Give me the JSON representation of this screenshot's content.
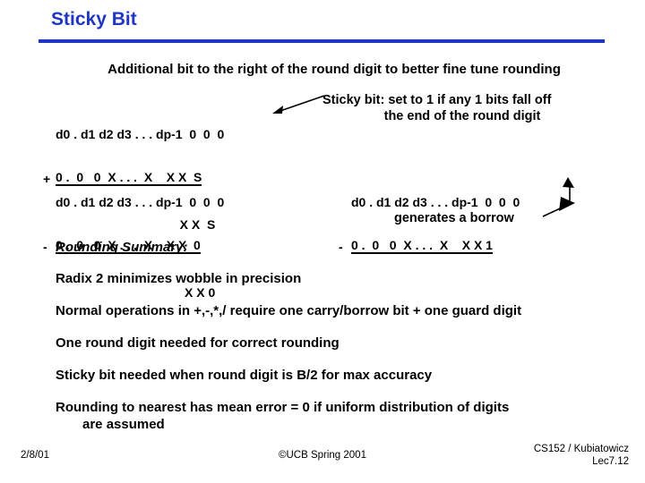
{
  "slide": {
    "title": "Sticky Bit",
    "accent_color": "#1F35C4",
    "lead_line": "Additional bit to the right of the round digit to better fine tune rounding"
  },
  "add_block": {
    "operand_top": "d0 . d1 d2 d3 . . . dp-1  0  0  0",
    "operator": "+",
    "operand_bottom": "0 .  0   0  X . . .  X    X X  S",
    "result": "X X  S"
  },
  "sticky_callout": {
    "line1": "Sticky bit:  set to 1 if any 1 bits fall off",
    "line2": "the end of the round digit",
    "arrow": "arrow-left-down"
  },
  "sub_block": {
    "operand_top": "d0 . d1 d2 d3 . . . dp-1  0  0  0",
    "operator": "-",
    "operand_bottom": "0 .  0   0  X . . .  X    X X  0",
    "result": "X X 0"
  },
  "borrow_block": {
    "operand_top": "d0 . d1 d2 d3 . . . dp-1  0  0  0",
    "operator": "-",
    "operand_bottom": "0 .  0   0  X . . .  X    X X 1",
    "caption": "generates a borrow",
    "arrow": "arrow-hook-up-left"
  },
  "summary": {
    "heading": "Rounding Summary:",
    "items": [
      "Radix 2 minimizes wobble in precision",
      "Normal operations in +,-,*,/ require one carry/borrow bit + one guard digit",
      "One round digit needed for correct rounding",
      "Sticky bit needed when round digit is B/2 for max accuracy"
    ],
    "last_item_line1": "Rounding to nearest has mean error = 0 if uniform distribution of digits",
    "last_item_line2": "are assumed"
  },
  "footer": {
    "date": "2/8/01",
    "center": "©UCB Spring 2001",
    "course": "CS152 / Kubiatowicz",
    "lecture": "Lec7.12"
  }
}
